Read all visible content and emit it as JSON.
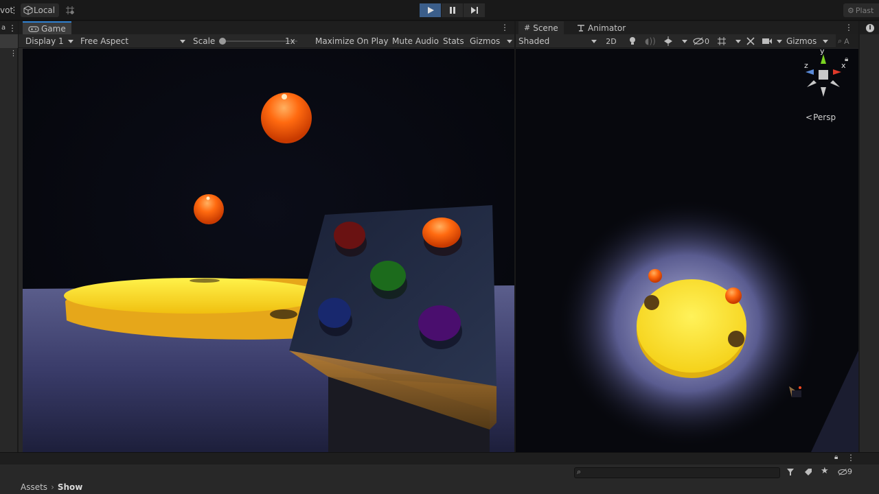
{
  "toolbar": {
    "pivot_label": "vot",
    "local_label": "Local",
    "plastic_label": "Plast"
  },
  "game_panel": {
    "tab_label": "Game",
    "display_label": "Display 1",
    "aspect_label": "Free Aspect",
    "scale_label": "Scale",
    "scale_value": "1x",
    "maximize_label": "Maximize On Play",
    "mute_label": "Mute Audio",
    "stats_label": "Stats",
    "gizmos_label": "Gizmos"
  },
  "scene_panel": {
    "tab_scene_label": "Scene",
    "tab_animator_label": "Animator",
    "shading_label": "Shaded",
    "mode_2d_label": "2D",
    "hidden_count": "0",
    "gizmos_label": "Gizmos",
    "search_label": "A",
    "gizmo_y": "y",
    "gizmo_x": "x",
    "gizmo_z": "z",
    "persp_label": "Persp"
  },
  "right_strip": {
    "label": "I"
  },
  "project": {
    "hidden_count": "9",
    "breadcrumb_root": "Assets",
    "breadcrumb_current": "Show"
  },
  "colors": {
    "accent": "#2f80d1",
    "play_active": "#3b5e8a",
    "sun_yellow": "#f6de2a",
    "orange_ball": "#f2660d"
  }
}
